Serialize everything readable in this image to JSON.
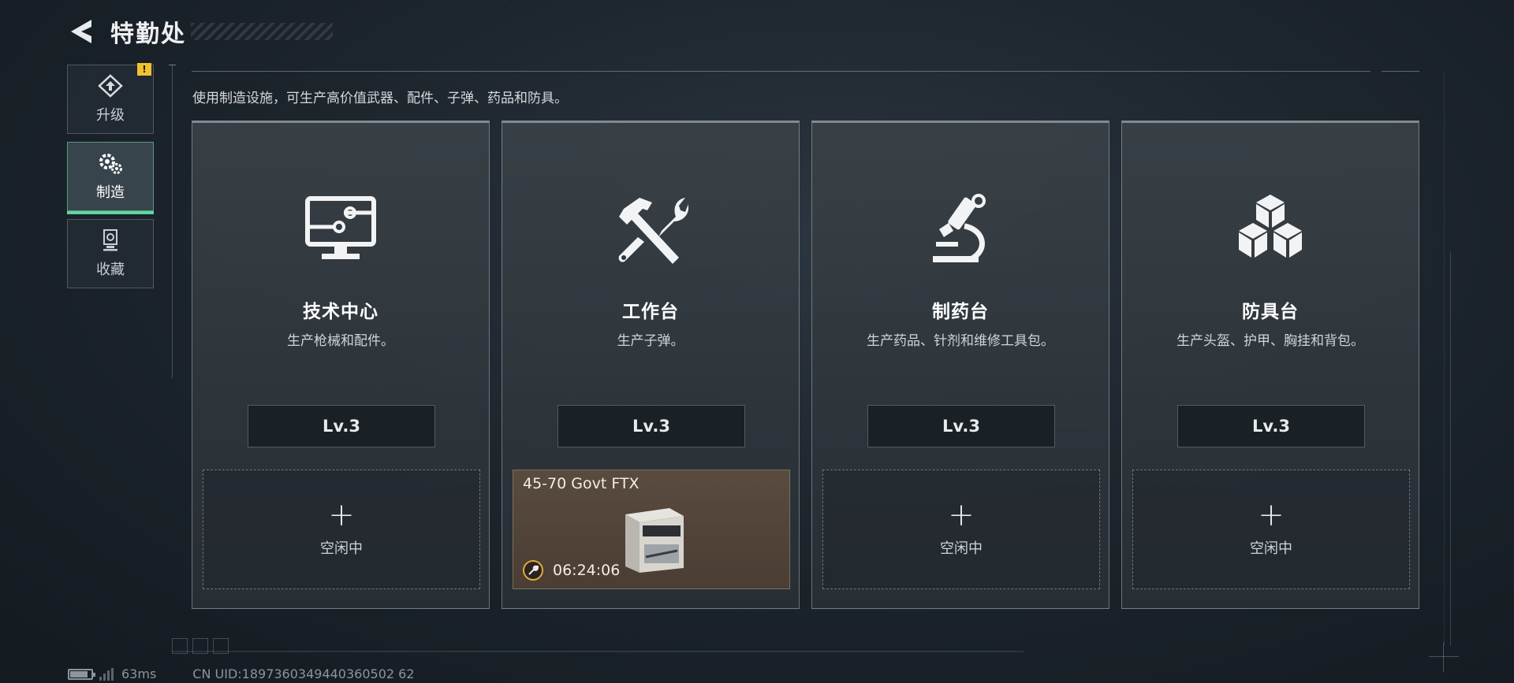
{
  "header": {
    "title": "特勤处"
  },
  "sidebar": {
    "items": [
      {
        "label": "升级",
        "icon": "upgrade-icon",
        "badge": "!"
      },
      {
        "label": "制造",
        "icon": "gears-icon",
        "active": true
      },
      {
        "label": "收藏",
        "icon": "trophy-icon"
      }
    ]
  },
  "description": "使用制造设施，可生产高价值武器、配件、子弹、药品和防具。",
  "cards": [
    {
      "name": "技术中心",
      "desc": "生产枪械和配件。",
      "level": "Lv.3",
      "icon": "monitor-icon",
      "slot": {
        "plus": "+",
        "status": "空闲中"
      }
    },
    {
      "name": "工作台",
      "desc": "生产子弹。",
      "level": "Lv.3",
      "icon": "hammer-wrench-icon",
      "slot": {
        "item_name": "45-70 Govt FTX",
        "timer": "06:24:06"
      }
    },
    {
      "name": "制药台",
      "desc": "生产药品、针剂和维修工具包。",
      "level": "Lv.3",
      "icon": "microscope-icon",
      "slot": {
        "plus": "+",
        "status": "空闲中"
      }
    },
    {
      "name": "防具台",
      "desc": "生产头盔、护甲、胸挂和背包。",
      "level": "Lv.3",
      "icon": "cubes-icon",
      "slot": {
        "plus": "+",
        "status": "空闲中"
      }
    }
  ],
  "status": {
    "ping": "63ms",
    "uid": "CN UID:1897360349440360502 62"
  },
  "colors": {
    "accent": "#5fd7a2",
    "badge": "#f0c230",
    "busy_slot": "#5a4b3f"
  }
}
